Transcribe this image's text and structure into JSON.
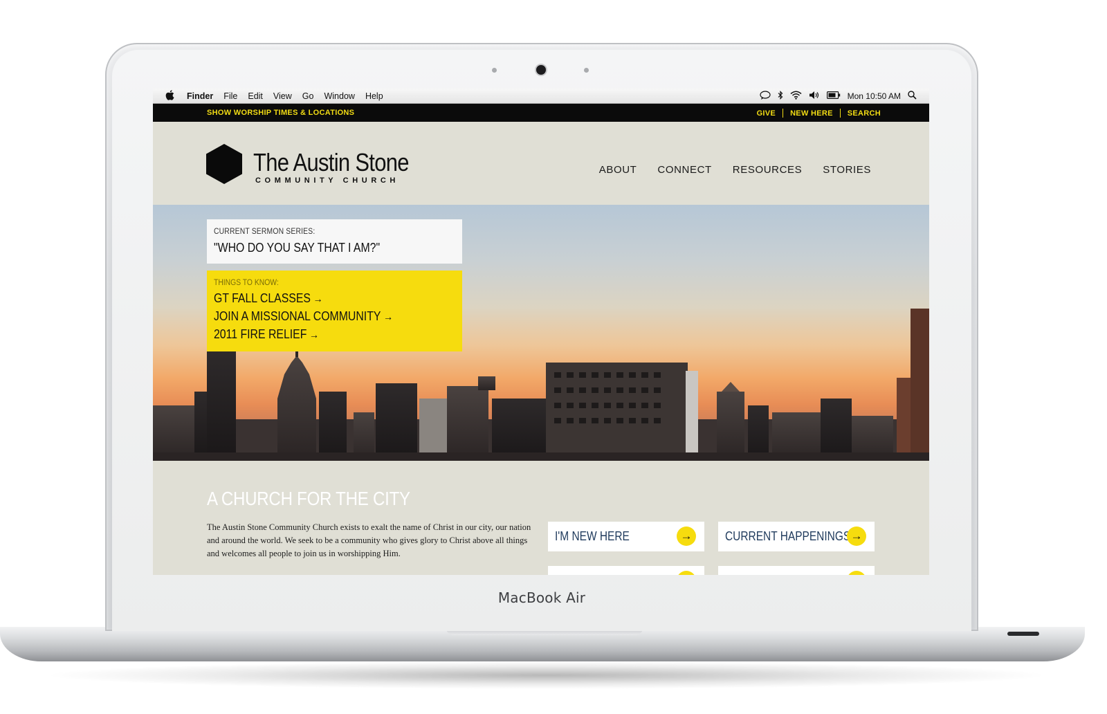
{
  "device": {
    "label": "MacBook Air"
  },
  "menubar": {
    "apple_icon": "apple-logo-icon",
    "items": [
      "Finder",
      "File",
      "Edit",
      "View",
      "Go",
      "Window",
      "Help"
    ],
    "clock": "Mon 10:50 AM",
    "status_icons": [
      "chat-bubble-icon",
      "bluetooth-icon",
      "wifi-icon",
      "volume-icon",
      "battery-icon",
      "spotlight-icon"
    ]
  },
  "topbar": {
    "worship_link": "SHOW WORSHIP TIMES & LOCATIONS",
    "links": [
      "GIVE",
      "NEW HERE",
      "SEARCH"
    ],
    "accent_color": "#f2dc14"
  },
  "header": {
    "logo_name": "The Austin Stone",
    "logo_subtitle": "COMMUNITY CHURCH",
    "nav": [
      "ABOUT",
      "CONNECT",
      "RESOURCES",
      "STORIES"
    ]
  },
  "hero": {
    "sermon": {
      "label": "CURRENT SERMON SERIES:",
      "title": "\"WHO DO YOU SAY THAT I AM?\""
    },
    "things_to_know": {
      "label": "THINGS TO KNOW:",
      "links": [
        "GT FALL CLASSES",
        "JOIN A MISSIONAL COMMUNITY",
        "2011 FIRE RELIEF"
      ],
      "arrow": "→",
      "box_color": "#f6dc0e"
    }
  },
  "content": {
    "heading": "A CHURCH FOR THE CITY",
    "paragraph": "The Austin Stone Community Church exists to exalt the name of Christ in our city, our nation and around the world. We seek to be a community who gives glory to Christ above all things and welcomes all people to join us in worshipping Him.",
    "ctas": [
      "I'M NEW HERE",
      "CURRENT HAPPENINGS"
    ],
    "cta_arrow": "→"
  }
}
